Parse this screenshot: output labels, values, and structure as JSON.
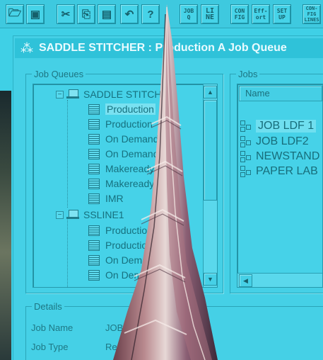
{
  "toolbar": {
    "buttons": [
      {
        "name": "open",
        "icon": "open-folder-icon",
        "glyph": "🗁"
      },
      {
        "name": "save",
        "icon": "save-disk-icon",
        "glyph": "▣"
      },
      {
        "name": "cut",
        "icon": "scissors-icon",
        "glyph": "✂"
      },
      {
        "name": "copy",
        "icon": "copy-icon",
        "glyph": "⎘"
      },
      {
        "name": "paste",
        "icon": "paste-icon",
        "glyph": "▤"
      },
      {
        "name": "undo",
        "icon": "undo-icon",
        "glyph": "↶"
      },
      {
        "name": "help",
        "icon": "help-icon",
        "glyph": "?"
      }
    ],
    "text_buttons": {
      "job_q": "JOB Q",
      "line": "LI NE",
      "config": "CON FIG",
      "effort": "Eff- ort",
      "setup": "SET UP",
      "config_lines": "CON- FIG LINES"
    }
  },
  "window": {
    "title": "SADDLE STITCHER : Production A Job Queue",
    "icon": "stitcher-app-icon"
  },
  "job_queues": {
    "label": "Job Queues",
    "tree": [
      {
        "type": "machine",
        "label": "SADDLE STITCHER",
        "expander": "−"
      },
      {
        "type": "queue",
        "label": "Production",
        "selected": true
      },
      {
        "type": "queue",
        "label": "Production"
      },
      {
        "type": "queue",
        "label": "On Demand"
      },
      {
        "type": "queue",
        "label": "On Demand"
      },
      {
        "type": "queue",
        "label": "Makeready"
      },
      {
        "type": "queue",
        "label": "Makeready"
      },
      {
        "type": "queue",
        "label": "IMR"
      },
      {
        "type": "machine",
        "label": "SSLINE1",
        "expander": "−"
      },
      {
        "type": "queue",
        "label": "Production"
      },
      {
        "type": "queue",
        "label": "Production"
      },
      {
        "type": "queue",
        "label": "On Demand"
      },
      {
        "type": "queue",
        "label": "On Demand"
      }
    ]
  },
  "jobs": {
    "label": "Jobs",
    "column_header": "Name",
    "items": [
      {
        "label": "JOB LDF 1",
        "selected": true
      },
      {
        "label": "JOB LDF2"
      },
      {
        "label": "NEWSTAND"
      },
      {
        "label": "PAPER LAB"
      }
    ]
  },
  "details": {
    "label": "Details",
    "job_name_label": "Job Name",
    "job_name_value": "JOB",
    "job_type_label": "Job Type",
    "job_type_value": "Re"
  },
  "colors": {
    "background": "#3fd0e6",
    "text": "#17636f",
    "title_text": "#e9fbff"
  }
}
